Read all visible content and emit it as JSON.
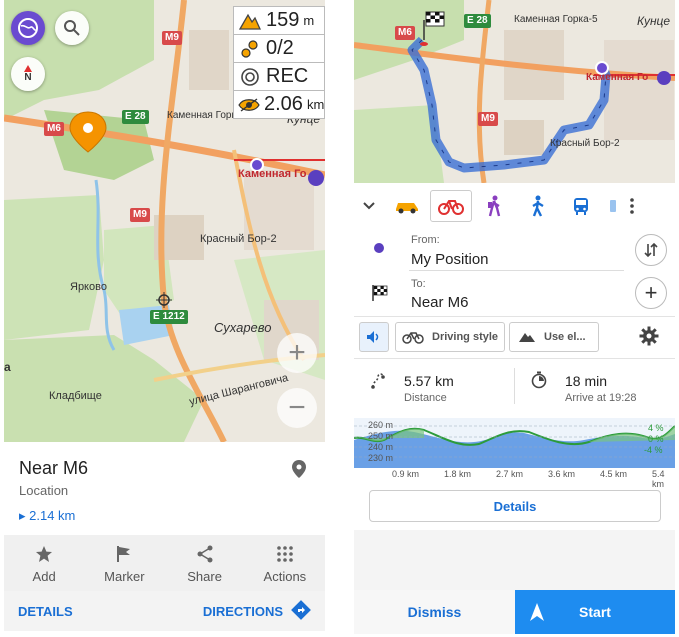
{
  "left": {
    "map": {
      "labels": {
        "m6": "M6",
        "e28": "E 28",
        "m9_top": "M9",
        "m9_mid": "M9",
        "e1212": "E 1212",
        "kamennaya_gorka": "Каменная Горка",
        "kamennaya_gor": "Каменная Го",
        "kuntse": "Кунце",
        "krasny_bor": "Красный Бор-2",
        "yarkovo": "Ярково",
        "sukharevo": "Сухарево",
        "sharangovicha": "улица Шаранговича",
        "kladbishche": "Кладбище",
        "a": "а",
        "north": "N"
      },
      "widgets": {
        "altitude_value": "159",
        "altitude_unit": "m",
        "points_value": "0/2",
        "rec_label": "REC",
        "distance_value": "2.06",
        "distance_unit": "km"
      }
    },
    "card": {
      "title": "Near M6",
      "subtitle": "Location",
      "distance": "▸ 2.14 km"
    },
    "actions": [
      {
        "label": "Add",
        "icon": "star-icon"
      },
      {
        "label": "Marker",
        "icon": "flag-icon"
      },
      {
        "label": "Share",
        "icon": "share-icon"
      },
      {
        "label": "Actions",
        "icon": "grid-dots-icon"
      }
    ],
    "footer": {
      "details": "DETAILS",
      "directions": "DIRECTIONS"
    }
  },
  "right": {
    "map": {
      "labels": {
        "m6": "M6",
        "e28": "E 28",
        "m9": "M9",
        "kamennaya_gorka5": "Каменная Горка-5",
        "kuntse": "Кунце",
        "kamennaya_gor": "Каменная Го",
        "krasny_bor": "Красный Бор-2"
      }
    },
    "modes": [
      "car-icon",
      "bicycle-icon",
      "hiker-icon",
      "walker-icon",
      "bus-icon",
      "more-icon"
    ],
    "from": {
      "label": "From:",
      "value": "My Position"
    },
    "to": {
      "label": "To:",
      "value": "Near M6"
    },
    "options": {
      "driving_style": "Driving style",
      "use_elevation": "Use el..."
    },
    "stats": {
      "distance_value": "5.57 km",
      "distance_label": "Distance",
      "time_value": "18 min",
      "time_label": "Arrive at 19:28"
    },
    "elevation": {
      "y_labels": [
        "260 m",
        "250 m",
        "240 m",
        "230 m"
      ],
      "x_labels": [
        "0.9 km",
        "1.8 km",
        "2.7 km",
        "3.6 km",
        "4.5 km",
        "5.4 km"
      ],
      "grade_labels": [
        "4 %",
        "0 %",
        "-4 %"
      ]
    },
    "details_button": "Details",
    "dismiss": "Dismiss",
    "start": "Start",
    "colors": {
      "accent": "#1e8cf0",
      "route": "#3b6fd4",
      "marker": "#f59300"
    }
  }
}
